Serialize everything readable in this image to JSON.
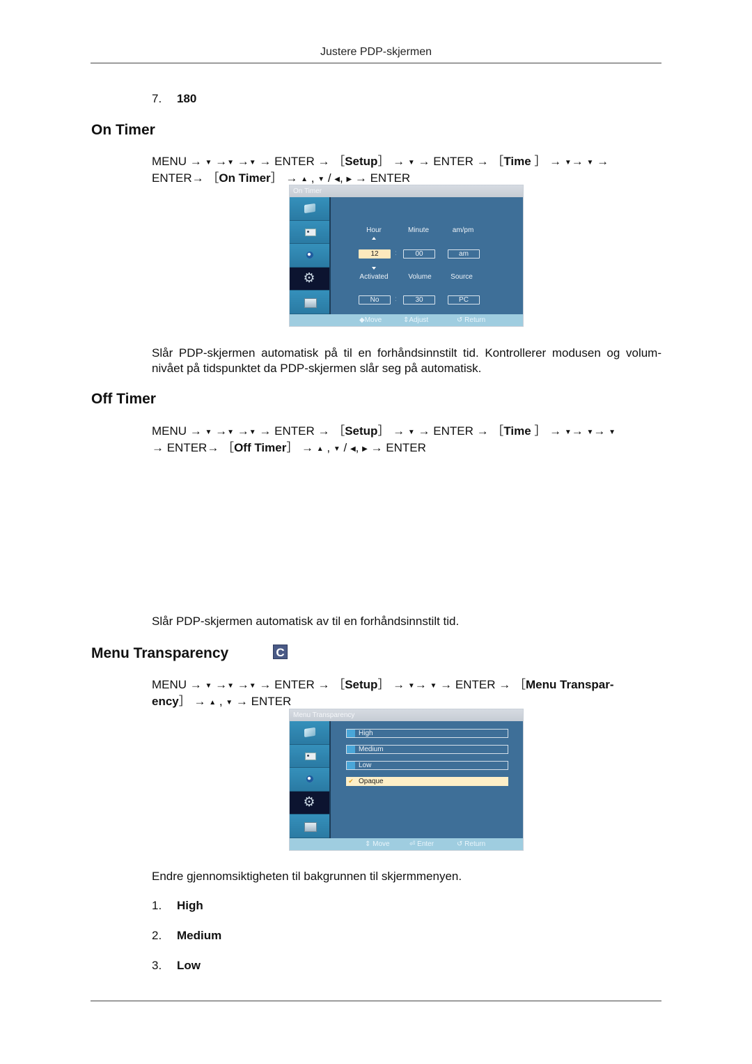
{
  "header": {
    "running_title": "Justere PDP-skjermen"
  },
  "top_item": {
    "number": "7.",
    "label": "180"
  },
  "on_timer": {
    "heading": "On Timer",
    "path_line1": {
      "a": "MENU → ",
      "g1": "▼",
      "b": " →",
      "g2": "▼",
      "c": " →",
      "g3": "▼",
      "d": " → ENTER → ［",
      "bold1": "Setup",
      "e": "］ → ",
      "g4": "▼",
      "f": " → ENTER → ［",
      "bold2": "Time",
      "g": " ］ → ",
      "g5": "▼",
      "h": "→ ",
      "g6": "▼",
      "i": " →"
    },
    "path_line2": {
      "a": "ENTER→ ［",
      "bold": "On Timer",
      "b": "］ → ",
      "g1": "▲",
      "c": " , ",
      "g2": "▼",
      "d": " / ",
      "g3": "◀",
      "e": ", ",
      "g4": "▶",
      "f": " → ENTER"
    },
    "description": "Slår PDP-skjermen automatisk på til en forhåndsinnstilt tid. Kontrollerer modusen og volum-nivået på tidspunktet da PDP-skjermen slår seg på automatisk.",
    "osd": {
      "title": "On Timer",
      "sidebar_icons": [
        "picture-icon",
        "sound-icon",
        "channel-icon",
        "setup-gear-icon",
        "input-icon"
      ],
      "active_sidebar_index": 3,
      "labels_row1": [
        "Hour",
        "Minute",
        "am/pm"
      ],
      "values_row1": [
        "12",
        "00",
        "am"
      ],
      "labels_row2": [
        "Activated",
        "Volume",
        "Source"
      ],
      "values_row2": [
        "No",
        "30",
        "PC"
      ],
      "separator": ":",
      "footer": {
        "move": "◆Move",
        "adjust": "⇕Adjust",
        "return": "↺ Return"
      }
    }
  },
  "off_timer": {
    "heading": "Off Timer",
    "path_line1": {
      "a": "MENU → ",
      "g1": "▼",
      "b": " →",
      "g2": "▼",
      "c": " →",
      "g3": "▼",
      "d": " → ENTER → ［",
      "bold1": "Setup",
      "e": "］ → ",
      "g4": "▼",
      "f": " → ENTER → ［",
      "bold2": "Time",
      "g": " ］ → ",
      "g5": "▼",
      "h": "→ ",
      "g6": "▼",
      "i": "→ ",
      "g7": "▼"
    },
    "path_line2": {
      "a": "→ ENTER→ ［",
      "bold": "Off Timer",
      "b": "］ → ",
      "g1": "▲",
      "c": " , ",
      "g2": "▼",
      "d": " / ",
      "g3": "◀",
      "e": ", ",
      "g4": "▶",
      "f": " → ENTER"
    },
    "description": "Slår PDP-skjermen automatisk av til en forhåndsinnstilt tid."
  },
  "menu_transparency": {
    "heading": "Menu Transparency",
    "badge": "C",
    "path_line1": {
      "a": "MENU → ",
      "g1": "▼",
      "b": " →",
      "g2": "▼",
      "c": " →",
      "g3": "▼",
      "d": " → ENTER → ［",
      "bold1": "Setup",
      "e": "］ → ",
      "g4": "▼",
      "f": "→ ",
      "g5": "▼",
      "g": " → ENTER → ［",
      "bold2": "Menu Transpar-"
    },
    "path_line2": {
      "bold": "ency",
      "a": "］ → ",
      "g1": "▲",
      "b": " , ",
      "g2": "▼",
      "c": " → ENTER"
    },
    "osd": {
      "title": "Menu Transparency",
      "options": [
        "High",
        "Medium",
        "Low",
        "Opaque"
      ],
      "selected_index": 3,
      "check_glyph": "✔",
      "footer": {
        "move": "⇕ Move",
        "enter": "⏎ Enter",
        "return": "↺ Return"
      }
    },
    "description": "Endre gjennomsiktigheten til bakgrunnen til skjermmenyen.",
    "list": [
      {
        "number": "1.",
        "label": "High"
      },
      {
        "number": "2.",
        "label": "Medium"
      },
      {
        "number": "3.",
        "label": "Low"
      }
    ]
  }
}
